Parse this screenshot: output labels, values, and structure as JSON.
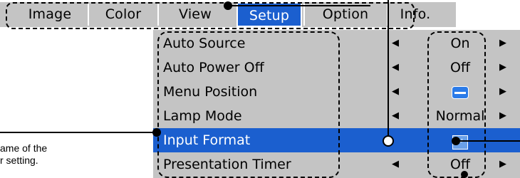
{
  "tabs": [
    {
      "label": "Image",
      "active": false
    },
    {
      "label": "Color",
      "active": false
    },
    {
      "label": "View",
      "active": false
    },
    {
      "label": "Setup",
      "active": true
    },
    {
      "label": "Option",
      "active": false
    },
    {
      "label": "Info.",
      "active": false
    }
  ],
  "menu": {
    "rows": [
      {
        "label": "Auto Source",
        "value": "On",
        "value_type": "text",
        "selected": false
      },
      {
        "label": "Auto Power Off",
        "value": "Off",
        "value_type": "text",
        "selected": false
      },
      {
        "label": "Menu Position",
        "value": "",
        "value_type": "position-icon",
        "selected": false
      },
      {
        "label": "Lamp Mode",
        "value": "Normal",
        "value_type": "text",
        "selected": false
      },
      {
        "label": "Input Format",
        "value": "",
        "value_type": "return-icon",
        "selected": true
      },
      {
        "label": "Presentation Timer",
        "value": "Off",
        "value_type": "text",
        "selected": false
      }
    ],
    "arrow_left": "◀",
    "arrow_right": "▶",
    "return_glyph": "↵"
  },
  "callout": {
    "line1": "ame of the",
    "line2": "r setting."
  },
  "colors": {
    "menu_background": "#c4c4c4",
    "selection": "#1b5fcf",
    "icon_blue": "#2b7be8"
  }
}
